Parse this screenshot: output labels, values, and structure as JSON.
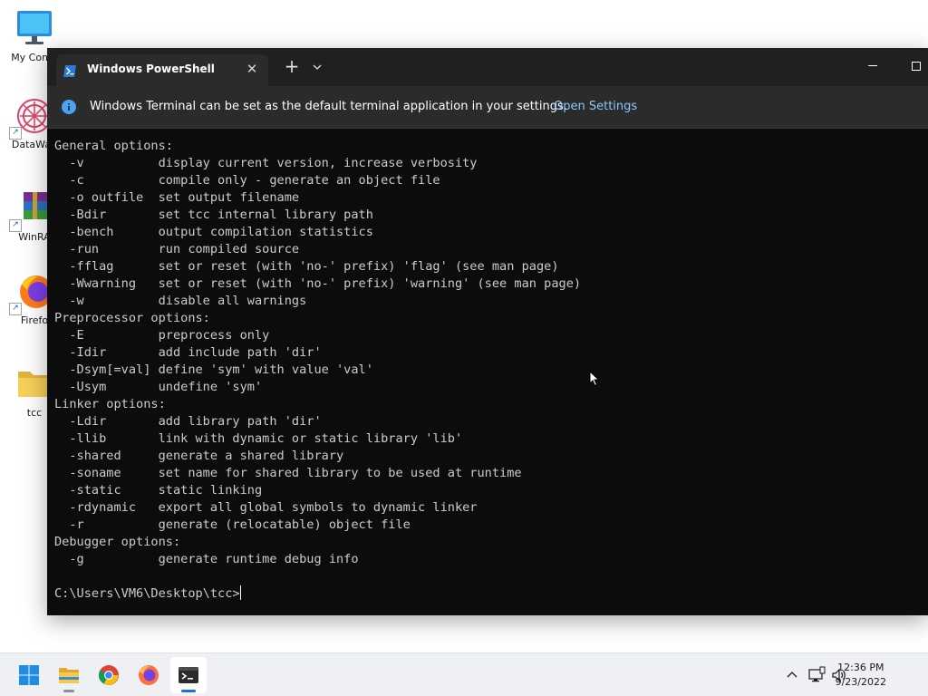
{
  "desktop": {
    "icons": [
      {
        "label": "My Comp",
        "icon": "computer-icon"
      },
      {
        "label": "DataWag",
        "icon": "app-shortcut-icon"
      },
      {
        "label": "WinRA",
        "icon": "winrar-icon"
      },
      {
        "label": "Firefo",
        "icon": "firefox-icon"
      },
      {
        "label": "tcc",
        "icon": "folder-icon"
      }
    ]
  },
  "terminal": {
    "tab_title": "Windows PowerShell",
    "info_message": "Windows Terminal can be set as the default terminal application in your settings.",
    "info_link": "Open Settings",
    "lines": [
      "General options:",
      "  -v          display current version, increase verbosity",
      "  -c          compile only - generate an object file",
      "  -o outfile  set output filename",
      "  -Bdir       set tcc internal library path",
      "  -bench      output compilation statistics",
      "  -run        run compiled source",
      "  -fflag      set or reset (with 'no-' prefix) 'flag' (see man page)",
      "  -Wwarning   set or reset (with 'no-' prefix) 'warning' (see man page)",
      "  -w          disable all warnings",
      "Preprocessor options:",
      "  -E          preprocess only",
      "  -Idir       add include path 'dir'",
      "  -Dsym[=val] define 'sym' with value 'val'",
      "  -Usym       undefine 'sym'",
      "Linker options:",
      "  -Ldir       add library path 'dir'",
      "  -llib       link with dynamic or static library 'lib'",
      "  -shared     generate a shared library",
      "  -soname     set name for shared library to be used at runtime",
      "  -static     static linking",
      "  -rdynamic   export all global symbols to dynamic linker",
      "  -r          generate (relocatable) object file",
      "Debugger options:",
      "  -g          generate runtime debug info",
      ""
    ],
    "prompt": "C:\\Users\\VM6\\Desktop\\tcc>"
  },
  "taskbar": {
    "apps": [
      "start-icon",
      "file-explorer-icon",
      "chrome-icon",
      "firefox-icon",
      "terminal-icon"
    ],
    "time": "12:36 PM",
    "date": "9/23/2022"
  },
  "colors": {
    "terminal_bg": "#0c0c0c",
    "terminal_text": "#cccccc",
    "titlebar": "#202020",
    "link": "#8cc8ff",
    "taskbar_bg": "#eef0f4"
  }
}
